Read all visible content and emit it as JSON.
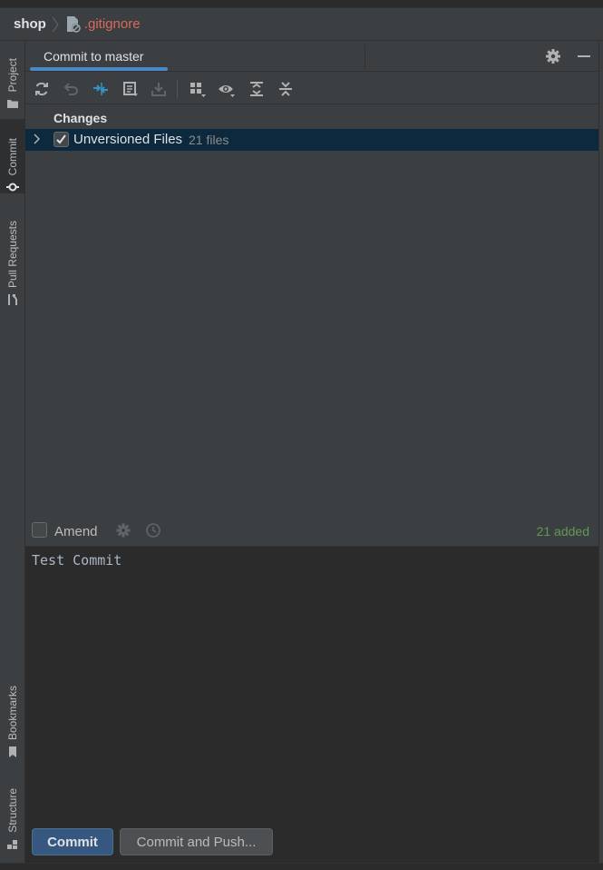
{
  "breadcrumb": {
    "project": "shop",
    "file": ".gitignore"
  },
  "left_strip": {
    "top_tabs": [
      {
        "label": "Project",
        "icon": "folder-icon"
      },
      {
        "label": "Commit",
        "icon": "commit-icon"
      },
      {
        "label": "Pull Requests",
        "icon": "pull-request-icon"
      }
    ],
    "bottom_tabs": [
      {
        "label": "Bookmarks",
        "icon": "bookmark-icon"
      },
      {
        "label": "Structure",
        "icon": "structure-icon"
      }
    ]
  },
  "panel": {
    "tab_label": "Commit to master",
    "header_icons": [
      "gear-icon",
      "minimize-icon"
    ]
  },
  "toolbar": {
    "icons": [
      "refresh-icon",
      "rollback-icon",
      "show-diff-icon",
      "changelist-icon",
      "shelve-icon",
      "group-by-icon",
      "view-options-icon",
      "expand-all-icon",
      "collapse-all-icon"
    ]
  },
  "changes": {
    "heading": "Changes",
    "rows": [
      {
        "label": "Unversioned Files",
        "count": "21 files",
        "checked": true
      }
    ]
  },
  "amend": {
    "label": "Amend",
    "checked": false,
    "added": "21 added"
  },
  "message": {
    "text": "Test Commit"
  },
  "buttons": {
    "commit": "Commit",
    "commit_and_push": "Commit and Push..."
  },
  "colors": {
    "accent": "#4a88c7",
    "selection": "#0d293e",
    "added": "#629755",
    "file_ignored": "#d9695b"
  }
}
